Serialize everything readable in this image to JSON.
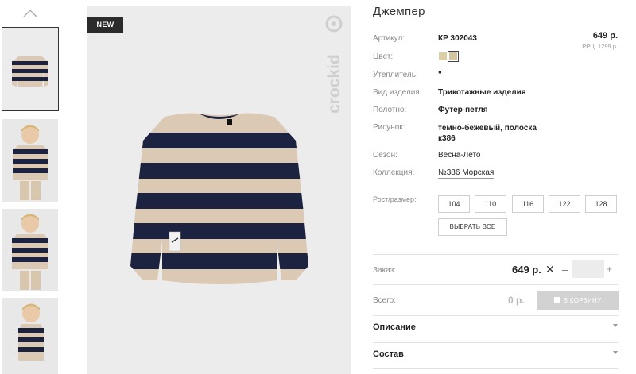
{
  "product": {
    "title": "Джемпер",
    "price": "649 р.",
    "rrp": "РРЦ: 1299 р.",
    "badge": "NEW",
    "brand": "crockid"
  },
  "attributes": [
    {
      "label": "Артикул:",
      "value": "КР 302043"
    },
    {
      "label": "Цвет:",
      "value": ""
    },
    {
      "label": "Утеплитель:",
      "value": "\""
    },
    {
      "label": "Вид изделия:",
      "value": "Трикотажные изделия"
    },
    {
      "label": "Полотно:",
      "value": "Футер-петля"
    },
    {
      "label": "Рисунок:",
      "value": "темно-бежевый, полоска к386"
    },
    {
      "label": "Сезон:",
      "value": "Весна-Лето"
    },
    {
      "label": "Коллекция:",
      "value": "№386 Морская"
    }
  ],
  "colors": {
    "swatches": [
      "#dccfa8",
      "#d3c6a0"
    ],
    "navy": "#1c2340",
    "beige": "#dcc9b4"
  },
  "sizes": {
    "label": "Рост/размер:",
    "options": [
      "104",
      "110",
      "116",
      "122",
      "128"
    ],
    "select_all": "ВЫБРАТЬ ВСЕ"
  },
  "order": {
    "label": "Заказ:",
    "price": "649 р.",
    "quantity": "",
    "minus": "–",
    "plus": "+",
    "remove": "✕"
  },
  "total": {
    "label": "Всего:",
    "value": "0 р.",
    "cart_button": "В КОРЗИНУ"
  },
  "accordion": [
    {
      "title": "Описание"
    },
    {
      "title": "Состав"
    }
  ],
  "thumbnails": [
    "product",
    "child-front",
    "child-front-2",
    "child-side"
  ]
}
